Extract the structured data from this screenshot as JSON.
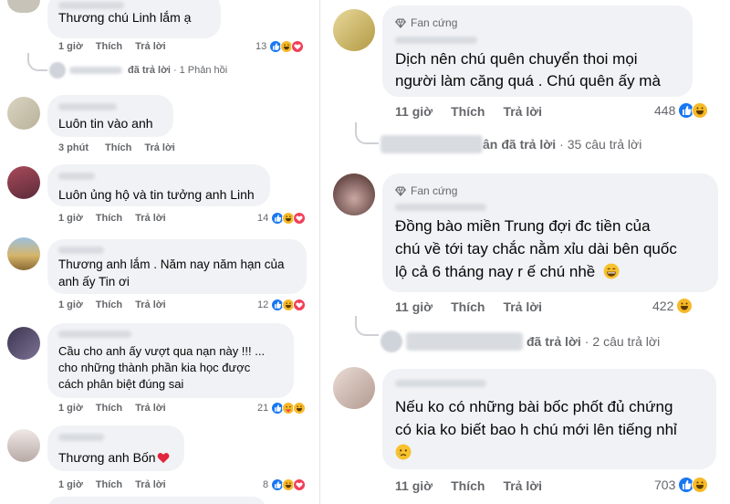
{
  "left": {
    "comments": [
      {
        "name_hint": "Đặng Hải Minh",
        "text_lines": [
          "Thương chú Linh lắm ạ"
        ],
        "time": "1 giờ",
        "like": "Thích",
        "reply": "Trả lời",
        "count": "13",
        "reactions": [
          "like",
          "haha",
          "love"
        ]
      },
      {
        "name_hint": "",
        "text_lines": [
          "Luôn tin vào anh"
        ],
        "time": "3 phút",
        "like": "Thích",
        "reply": "Trả lời",
        "count": "",
        "reactions": []
      },
      {
        "name_hint": "",
        "text_lines": [
          "Luôn ủng hộ và tin tưởng anh Linh"
        ],
        "time": "1 giờ",
        "like": "Thích",
        "reply": "Trả lời",
        "count": "14",
        "reactions": [
          "like",
          "haha",
          "love"
        ]
      },
      {
        "name_hint": "",
        "text_lines": [
          "Thương anh lắm . Năm nay năm hạn của",
          "anh ấy Tin ơi"
        ],
        "time": "1 giờ",
        "like": "Thích",
        "reply": "Trả lời",
        "count": "12",
        "reactions": [
          "like",
          "haha",
          "love"
        ]
      },
      {
        "name_hint": "",
        "text_lines": [
          "Cầu cho anh ấy vượt qua nạn này !!! ...",
          "cho những thành phần kia học được",
          "cách phân biệt đúng sai"
        ],
        "time": "1 giờ",
        "like": "Thích",
        "reply": "Trả lời",
        "count": "21",
        "reactions": [
          "like",
          "care",
          "haha"
        ]
      },
      {
        "name_hint": "",
        "text_lines": [
          "Thương anh Bốn"
        ],
        "time": "1 giờ",
        "like": "Thích",
        "reply": "Trả lời",
        "count": "8",
        "reactions": [
          "like",
          "haha",
          "love"
        ]
      }
    ],
    "reply_summary": {
      "replied": "đã trả lời",
      "count": "1 Phản hồi"
    }
  },
  "right": {
    "comments": [
      {
        "badge": "Fan cứng",
        "text_lines": [
          "Dịch nên chú quên chuyển thoi mọi",
          "người làm căng quá . Chú quên ấy mà"
        ],
        "time": "11 giờ",
        "like": "Thích",
        "reply": "Trả lời",
        "count": "448",
        "reactions": [
          "like",
          "haha"
        ],
        "reply_summary": {
          "name_suffix": "ân",
          "replied": "đã trả lời",
          "count": "35 câu trả lời"
        }
      },
      {
        "badge": "Fan cứng",
        "text_lines": [
          "Đồng bào miền Trung đợi đc tiền của",
          "chú về tới tay chắc nằm xỉu dài bên quốc",
          "lộ cả 6 tháng nay r ế chú nhề"
        ],
        "time": "11 giờ",
        "like": "Thích",
        "reply": "Trả lời",
        "count": "422",
        "reactions": [
          "haha"
        ],
        "reply_summary": {
          "name_suffix": "",
          "replied": "đã trả lời",
          "count": "2 câu trả lời"
        }
      },
      {
        "badge": "",
        "text_lines": [
          "Nếu ko có những bài bốc phốt đủ chứng",
          "có kia ko biết bao h chú mới lên tiếng nhỉ"
        ],
        "time": "11 giờ",
        "like": "Thích",
        "reply": "Trả lời",
        "count": "703",
        "reactions": [
          "like",
          "haha"
        ]
      }
    ]
  },
  "icons": {
    "badge": "diamond-icon",
    "heart": "heart-emoji-icon",
    "smile": "grinning-emoji-icon",
    "sad": "crying-emoji-icon"
  },
  "colors": {
    "bubble": "#f0f2f5",
    "meta": "#65676b",
    "like": "#1877f2",
    "haha": "#f7b928",
    "love": "#f33e58"
  }
}
